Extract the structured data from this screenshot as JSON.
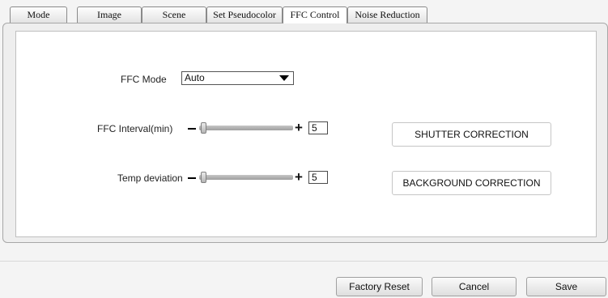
{
  "tabs": [
    {
      "label": "Mode"
    },
    {
      "label": "Image"
    },
    {
      "label": "Scene"
    },
    {
      "label": "Set Pseudocolor"
    },
    {
      "label": "FFC Control",
      "active": true
    },
    {
      "label": "Noise Reduction"
    }
  ],
  "ffc_mode": {
    "label": "FFC Mode",
    "value": "Auto"
  },
  "ffc_interval": {
    "label": "FFC Interval(min)",
    "value": "5",
    "slider_position": 0
  },
  "temp_deviation": {
    "label": "Temp deviation",
    "value": "5",
    "slider_position": 0
  },
  "buttons": {
    "shutter_correction": "SHUTTER CORRECTION",
    "background_correction": "BACKGROUND CORRECTION"
  },
  "footer": {
    "factory_reset": "Factory Reset",
    "cancel": "Cancel",
    "save": "Save"
  }
}
